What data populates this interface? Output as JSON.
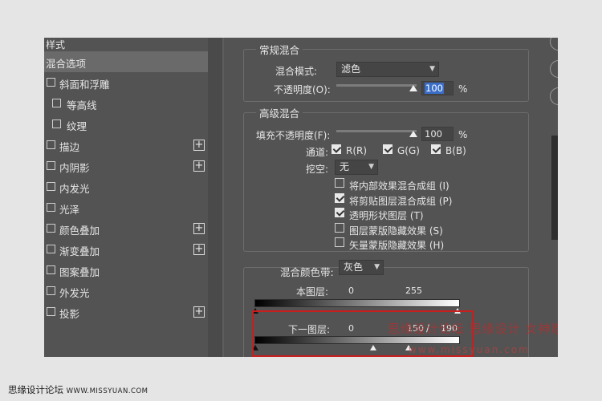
{
  "sidebar": {
    "header": "样式",
    "items": [
      {
        "label": "混合选项",
        "checkbox": false,
        "plus": false,
        "selected": true
      },
      {
        "label": "斜面和浮雕",
        "checkbox": true,
        "plus": false
      },
      {
        "label": "等高线",
        "checkbox": true,
        "plus": false,
        "indent": true
      },
      {
        "label": "纹理",
        "checkbox": true,
        "plus": false,
        "indent": true
      },
      {
        "label": "描边",
        "checkbox": true,
        "plus": true
      },
      {
        "label": "内阴影",
        "checkbox": true,
        "plus": true
      },
      {
        "label": "内发光",
        "checkbox": true,
        "plus": false
      },
      {
        "label": "光泽",
        "checkbox": true,
        "plus": false
      },
      {
        "label": "颜色叠加",
        "checkbox": true,
        "plus": true
      },
      {
        "label": "渐变叠加",
        "checkbox": true,
        "plus": true
      },
      {
        "label": "图案叠加",
        "checkbox": true,
        "plus": false
      },
      {
        "label": "外发光",
        "checkbox": true,
        "plus": false
      },
      {
        "label": "投影",
        "checkbox": true,
        "plus": true
      }
    ],
    "plus_glyph": "+"
  },
  "general_blend": {
    "title": "常规混合",
    "mode_label": "混合模式:",
    "mode_value": "滤色",
    "opacity_label": "不透明度(O):",
    "opacity_value": "100",
    "percent": "%"
  },
  "advanced_blend": {
    "title": "高级混合",
    "fill_label": "填充不透明度(F):",
    "fill_value": "100",
    "percent": "%",
    "channels_label": "通道:",
    "channel_r": "R(R)",
    "channel_g": "G(G)",
    "channel_b": "B(B)",
    "knockout_label": "挖空:",
    "knockout_value": "无",
    "options": [
      {
        "label": "将内部效果混合成组 (I)",
        "checked": false
      },
      {
        "label": "将剪贴图层混合成组 (P)",
        "checked": true
      },
      {
        "label": "透明形状图层 (T)",
        "checked": true
      },
      {
        "label": "图层蒙版隐藏效果 (S)",
        "checked": false
      },
      {
        "label": "矢量蒙版隐藏效果 (H)",
        "checked": false
      }
    ]
  },
  "blend_if": {
    "label": "混合颜色带:",
    "value": "灰色",
    "this_layer_label": "本图层:",
    "this_layer_min": "0",
    "this_layer_max": "255",
    "underlying_label": "下一图层:",
    "underlying_min": "0",
    "underlying_split_low": "150",
    "separator": "/",
    "underlying_split_high": "190"
  },
  "watermark": {
    "cn": "思缘设计论坛 思缘设计 女神原创翻译",
    "url": "www.missyuan.com"
  },
  "footer": {
    "site_cn": "思缘设计论坛",
    "site_url": "WWW.MISSYUAN.COM"
  },
  "colors": {
    "panel_bg": "#535353",
    "highlight_red": "#c81e1e",
    "selection_blue": "#3a6ec8"
  }
}
